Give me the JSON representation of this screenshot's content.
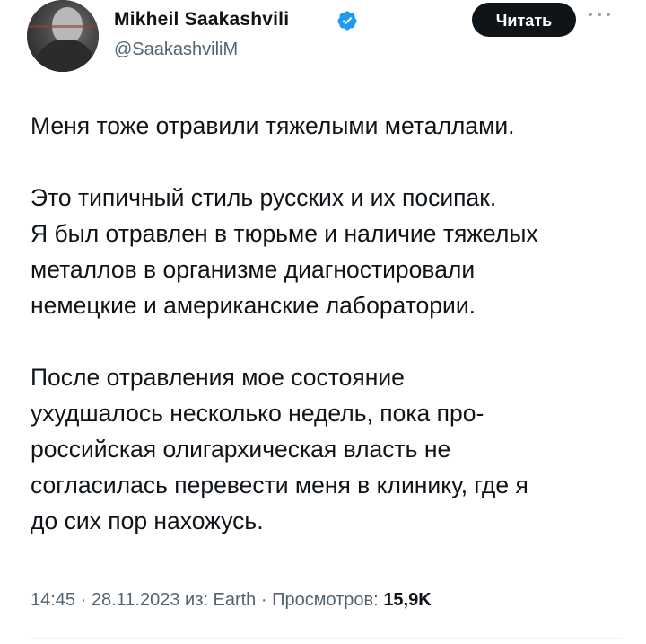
{
  "author": {
    "name": "Mikheil Saakashvili",
    "handle": "@SaakashviliM",
    "verified": true,
    "verified_color": "#1d9bf0"
  },
  "follow_button": {
    "label": "Читать",
    "background": "#0f1419"
  },
  "more_icon": "ellipsis-icon",
  "tweet": {
    "paragraph1": [
      "Меня тоже отравили тяжелыми металлами."
    ],
    "paragraph2": [
      "Это типичный стиль русских и их посипак.",
      "Я был отравлен в тюрьме и наличие тяжелых",
      "металлов в организме диагностировали",
      "немецкие и американские лаборатории."
    ],
    "paragraph3": [
      "После отравления мое состояние",
      "ухудшалось несколько недель, пока про-",
      "российская олигархическая власть не",
      "согласилась перевести меня в клинику, где я",
      "до сих пор нахожусь."
    ]
  },
  "meta": {
    "time": "14:45",
    "date": "28.11.2023",
    "source_prefix": "из:",
    "source": "Earth",
    "views_label": "Просмотров:",
    "views_count": "15,9K"
  },
  "colors": {
    "text": "#0f1419",
    "secondary_text": "#536471"
  }
}
